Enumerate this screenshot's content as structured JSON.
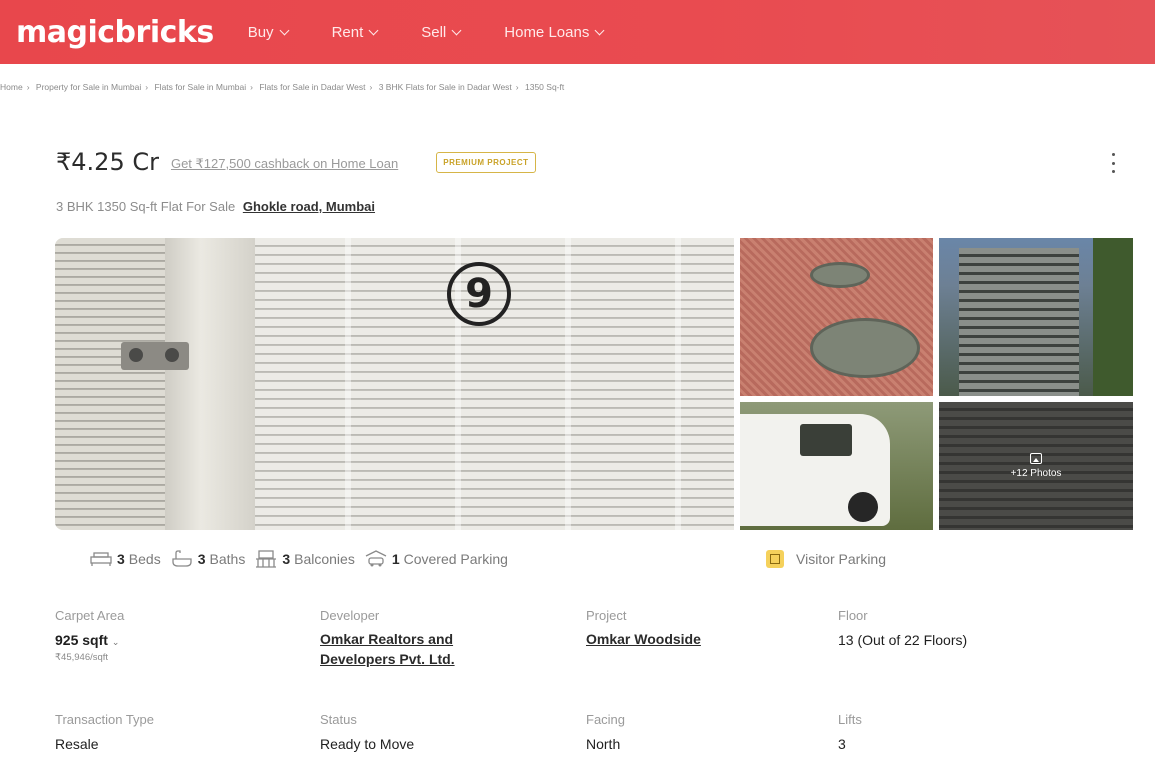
{
  "header": {
    "logo": "magicbricks",
    "nav": [
      {
        "label": "Buy"
      },
      {
        "label": "Rent"
      },
      {
        "label": "Sell"
      },
      {
        "label": "Home Loans"
      }
    ]
  },
  "breadcrumb": [
    "Home",
    "Property for Sale in Mumbai",
    "Flats for Sale in Mumbai",
    "Flats for Sale in Dadar West",
    "3 BHK Flats for Sale in Dadar West",
    "1350 Sq-ft"
  ],
  "listing": {
    "price": "₹4.25 Cr",
    "cashback": "Get ₹127,500 cashback on Home Loan",
    "badge": "PREMIUM PROJECT",
    "subtitle": "3 BHK 1350 Sq-ft Flat For Sale",
    "location": "Ghokle road, Mumbai"
  },
  "gallery": {
    "main_photo_number": "9",
    "more_photos": "+12 Photos"
  },
  "amenities": {
    "beds_count": "3",
    "beds_label": "Beds",
    "baths_count": "3",
    "baths_label": "Baths",
    "balconies_count": "3",
    "balconies_label": "Balconies",
    "parking_count": "1",
    "parking_label": "Covered Parking",
    "visitor_parking": "Visitor Parking"
  },
  "details": {
    "carpet_area": {
      "label": "Carpet Area",
      "value": "925 sqft",
      "sub": "₹45,946/sqft"
    },
    "developer": {
      "label": "Developer",
      "value_line1": "Omkar Realtors and",
      "value_line2": "Developers Pvt. Ltd."
    },
    "project": {
      "label": "Project",
      "value": "Omkar Woodside"
    },
    "floor": {
      "label": "Floor",
      "value": "13 (Out of 22 Floors)"
    },
    "transaction_type": {
      "label": "Transaction Type",
      "value": "Resale"
    },
    "status": {
      "label": "Status",
      "value": "Ready to Move"
    },
    "facing": {
      "label": "Facing",
      "value": "North"
    },
    "lifts": {
      "label": "Lifts",
      "value": "3"
    }
  },
  "colors": {
    "brand": "#e8474c",
    "badge": "#c9a227"
  }
}
